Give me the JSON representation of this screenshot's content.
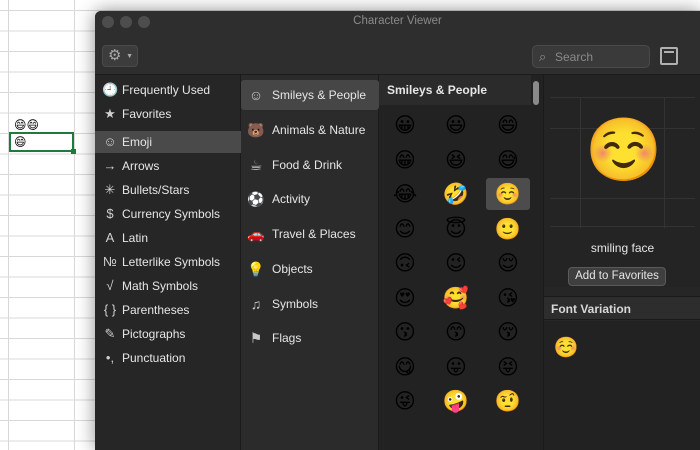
{
  "spreadsheet": {
    "cell_emojis_row1": "😄😄",
    "cell_emojis_row2": "😄"
  },
  "window": {
    "title": "Character Viewer"
  },
  "toolbar": {
    "gear_icon": "⚙",
    "search_placeholder": "Search"
  },
  "sidebar": {
    "items": [
      {
        "icon": "🕘",
        "label": "Frequently Used"
      },
      {
        "icon": "★",
        "label": "Favorites"
      },
      {
        "icon": "☺",
        "label": "Emoji",
        "active": true
      },
      {
        "icon": "→",
        "label": "Arrows"
      },
      {
        "icon": "✳",
        "label": "Bullets/Stars"
      },
      {
        "icon": "$",
        "label": "Currency Symbols"
      },
      {
        "icon": "A",
        "label": "Latin"
      },
      {
        "icon": "№",
        "label": "Letterlike Symbols"
      },
      {
        "icon": "√",
        "label": "Math Symbols"
      },
      {
        "icon": "{ }",
        "label": "Parentheses"
      },
      {
        "icon": "✎",
        "label": "Pictographs"
      },
      {
        "icon": "•,",
        "label": "Punctuation"
      }
    ]
  },
  "categories": {
    "items": [
      {
        "icon": "☺",
        "label": "Smileys & People",
        "active": true
      },
      {
        "icon": "🐻",
        "label": "Animals & Nature"
      },
      {
        "icon": "☕",
        "label": "Food & Drink"
      },
      {
        "icon": "⚽",
        "label": "Activity"
      },
      {
        "icon": "🚗",
        "label": "Travel & Places"
      },
      {
        "icon": "💡",
        "label": "Objects"
      },
      {
        "icon": "♫",
        "label": "Symbols"
      },
      {
        "icon": "⚑",
        "label": "Flags"
      }
    ]
  },
  "emoji_grid": {
    "header": "Smileys & People",
    "rows": [
      [
        "😀",
        "😃",
        "😄"
      ],
      [
        "😁",
        "😆",
        "😅"
      ],
      [
        "😂",
        "🤣",
        "☺️"
      ],
      [
        "😊",
        "😇",
        "🙂"
      ],
      [
        "🙃",
        "😉",
        "😌"
      ],
      [
        "😍",
        "🥰",
        "😘"
      ],
      [
        "😗",
        "😙",
        "😚"
      ],
      [
        "😋",
        "😛",
        "😝"
      ],
      [
        "😜",
        "🤪",
        "🤨"
      ]
    ],
    "selected": {
      "row": 2,
      "col": 2
    }
  },
  "preview": {
    "emoji": "☺️",
    "name": "smiling face",
    "add_favorites_label": "Add to Favorites"
  },
  "font_variation": {
    "header": "Font Variation",
    "emoji": "☺️"
  }
}
